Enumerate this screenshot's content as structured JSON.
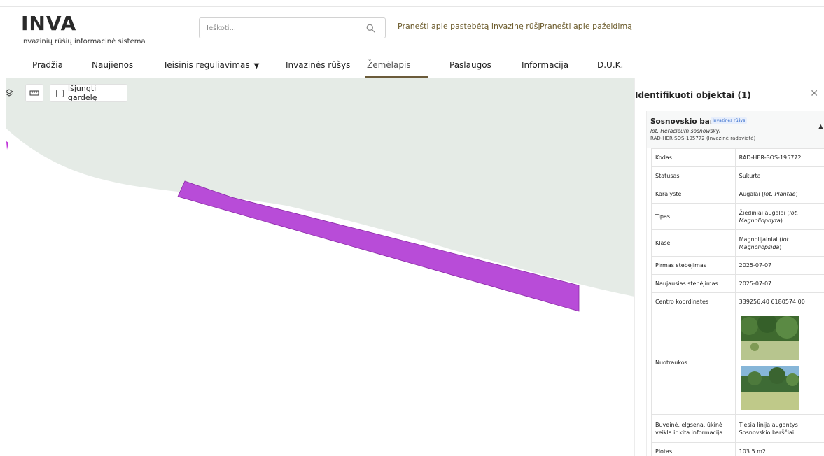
{
  "header": {
    "logo": "INVA",
    "logo_subtitle": "Invazinių rūšių informacinė sistema",
    "search_placeholder": "Ieškoti...",
    "links": [
      "Pranešti apie pastebėtą invazinę rūšį",
      "Pranešti apie pažeidimą"
    ]
  },
  "nav": {
    "items": [
      "Pradžia",
      "Naujienos",
      "Teisinis reguliavimas",
      "Invazinės rūšys",
      "Žemėlapis",
      "Paslaugos",
      "Informacija",
      "D.U.K."
    ],
    "active": "Žemėlapis"
  },
  "map": {
    "grid_toggle_label": "Išjungti gardelę",
    "grid_toggle_checked": false,
    "polygon_color": "#b84cd8",
    "land_color": "#e5ebe6"
  },
  "panel": {
    "title": "Identifikuoti objektai (1)",
    "object": {
      "name": "Sosnovskio barštis",
      "badge": "Invazinės rūšys",
      "latin": "lot. Heracleum sosnowskyi",
      "reference": "RAD-HER-SOS-195772 (Invazinė radavietė)"
    },
    "rows": [
      {
        "key": "Kodas",
        "value": "RAD-HER-SOS-195772"
      },
      {
        "key": "Statusas",
        "value": "Sukurta"
      },
      {
        "key": "Karalystė",
        "value": "Augalai (lot. Plantae)"
      },
      {
        "key": "Tipas",
        "value": "Žiediniai augalai (lot. Magnoliophyta)"
      },
      {
        "key": "Klasė",
        "value": "Magnolijainiai (lot. Magnoliopsida)"
      },
      {
        "key": "Pirmas stebėjimas",
        "value": "2025-07-07"
      },
      {
        "key": "Naujausias stebėjimas",
        "value": "2025-07-07"
      },
      {
        "key": "Centro koordinatės",
        "value": "339256.40 6180574.00"
      },
      {
        "key": "Nuotraukos",
        "value": ""
      },
      {
        "key": "Buveinė, elgsena, ūkinė veikla ir kita informacija",
        "value": "Tiesia linija augantys Sosnovskio barščiai."
      },
      {
        "key": "Plotas",
        "value": "103.5 m2"
      }
    ]
  }
}
